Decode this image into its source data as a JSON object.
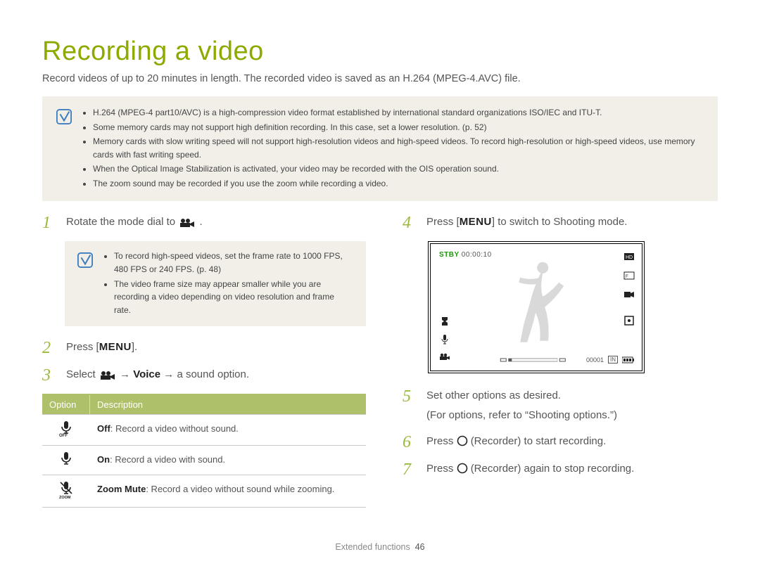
{
  "title": "Recording a video",
  "intro": "Record videos of up to 20 minutes in length. The recorded video is saved as an H.264 (MPEG-4.AVC) file.",
  "top_notes": [
    "H.264 (MPEG-4 part10/AVC) is a high-compression video format established by international standard organizations ISO/IEC and ITU-T.",
    "Some memory cards may not support high definition recording. In this case, set a lower resolution. (p. 52)",
    "Memory cards with slow writing speed will not support high-resolution videos and high-speed videos. To record high-resolution or high-speed videos, use memory cards with fast writing speed.",
    "When the Optical Image Stabilization is activated, your video may be recorded with the OIS operation sound.",
    "The zoom sound may be recorded if you use the zoom while recording a video."
  ],
  "left": {
    "step1_pre": "Rotate the mode dial to ",
    "step1_post": ".",
    "step1_notes": [
      "To record high-speed videos, set the frame rate to 1000 FPS, 480 FPS or 240 FPS. (p. 48)",
      "The video frame size may appear smaller while you are recording a video depending on video resolution and frame rate."
    ],
    "step2_pre": "Press [",
    "step2_menu": "MENU",
    "step2_post": "].",
    "step3_pre": "Select ",
    "step3_voice": "Voice",
    "step3_post": " a sound option.",
    "table": {
      "h_option": "Option",
      "h_desc": "Description",
      "rows": [
        {
          "label": "Off",
          "desc": ": Record a video without sound."
        },
        {
          "label": "On",
          "desc": ": Record a video with sound."
        },
        {
          "label": "Zoom Mute",
          "desc": ": Record a video without sound while zooming."
        }
      ]
    }
  },
  "right": {
    "step4_pre": "Press [",
    "step4_menu": "MENU",
    "step4_post": "] to switch to Shooting mode.",
    "preview": {
      "stby": "STBY",
      "time": "00:00:10",
      "counter": "00001",
      "in_label": "IN"
    },
    "step5a": "Set other options as desired.",
    "step5b": "(For options, refer to “Shooting options.”)",
    "step6_pre": "Press ",
    "step6_post": " (Recorder) to start recording.",
    "step7_pre": "Press ",
    "step7_post": " (Recorder) again to stop recording."
  },
  "footer": {
    "section": "Extended functions",
    "page": "46"
  }
}
